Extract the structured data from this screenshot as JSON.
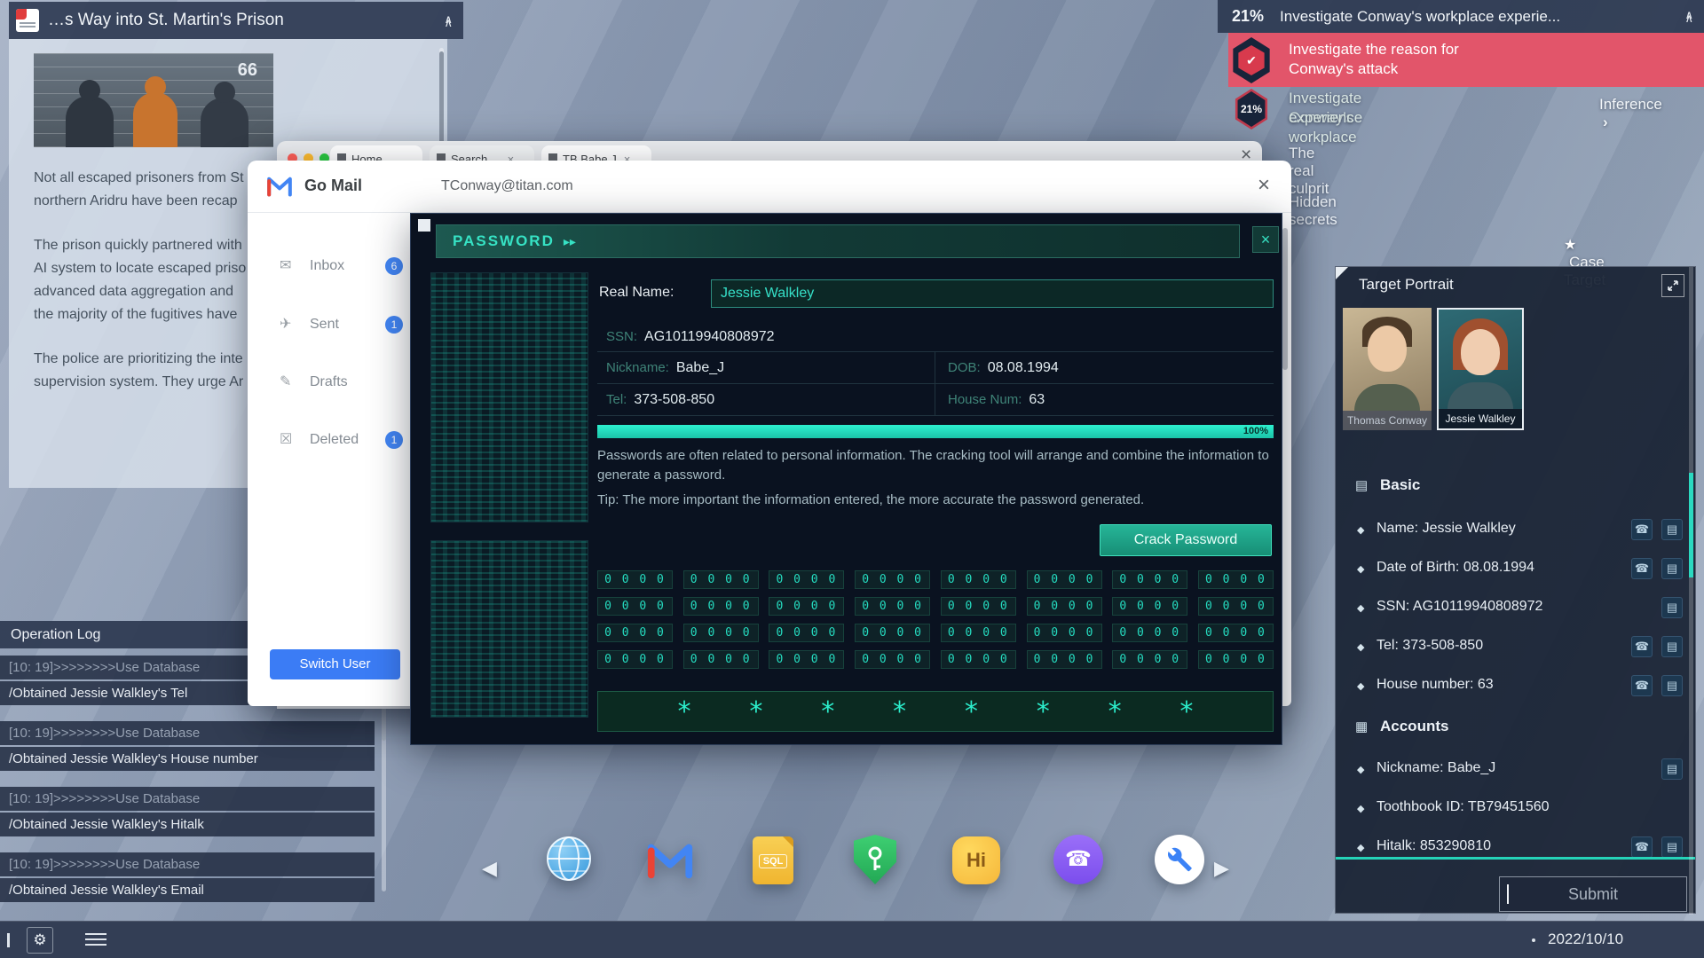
{
  "icons": {
    "collapse": "∧",
    "check": "✔",
    "chevron_right": "›",
    "star": "★",
    "bullet": "◆",
    "close": "×",
    "arrows": "▸▸",
    "contact": "☎",
    "note": "▤",
    "basic_section": "▤",
    "accounts_section": "▦",
    "inbox": "✉",
    "sent": "✈",
    "drafts": "✎",
    "deleted": "☒",
    "gear": "⚙",
    "prev": "◀",
    "next": "▶"
  },
  "news": {
    "title": "…s Way into St. Martin's Prison",
    "image_number": "66",
    "paragraphs": [
      [
        "Not all escaped prisoners from St",
        "northern Aridru have been recap"
      ],
      [
        "The prison quickly partnered with",
        "AI system to locate escaped priso",
        "advanced data aggregation and",
        "the majority of the fugitives have"
      ],
      [
        "The police are prioritizing the inte",
        "supervision system. They urge Ar"
      ]
    ]
  },
  "tasks": {
    "percent": "21%",
    "header_title": "Investigate Conway's workplace experie...",
    "completed": {
      "line1": "Investigate the reason for",
      "line2": "Conway's attack"
    },
    "current": {
      "percent": "21%",
      "line1": "Investigate Conway's workplace",
      "line2": "experience",
      "action": "Inference"
    },
    "items": [
      "The real culprit",
      "Hidden secrets"
    ],
    "case_target_label": "Case Target"
  },
  "target_panel": {
    "title": "Target Portrait",
    "portraits": [
      {
        "name": "Thomas Conway"
      },
      {
        "name": "Jessie Walkley"
      }
    ],
    "basic": {
      "title": "Basic",
      "items": [
        {
          "text": "Name: Jessie Walkley"
        },
        {
          "text": "Date of Birth: 08.08.1994"
        },
        {
          "text": "SSN: AG10119940808972"
        },
        {
          "text": "Tel: 373-508-850"
        },
        {
          "text": "House number: 63"
        }
      ]
    },
    "accounts": {
      "title": "Accounts",
      "items": [
        {
          "text": "Nickname: Babe_J"
        },
        {
          "text": "Toothbook ID: TB79451560"
        },
        {
          "text": "Hitalk: 853290810"
        }
      ]
    },
    "submit_label": "Submit"
  },
  "operation_log": {
    "title": "Operation Log",
    "entries": [
      {
        "line1": "[10: 19]>>>>>>>>Use Database",
        "line2": "/Obtained Jessie Walkley's Tel"
      },
      {
        "line1": "[10: 19]>>>>>>>>Use Database",
        "line2": "/Obtained Jessie Walkley's House number"
      },
      {
        "line1": "[10: 19]>>>>>>>>Use Database",
        "line2": "/Obtained Jessie Walkley's Hitalk"
      },
      {
        "line1": "[10: 19]>>>>>>>>Use Database",
        "line2": "/Obtained Jessie Walkley's Email"
      }
    ]
  },
  "browser": {
    "tabs": [
      {
        "label": "Home"
      },
      {
        "label": "Search ..."
      },
      {
        "label": "TB Babe J"
      }
    ]
  },
  "mail": {
    "brand": "Go Mail",
    "account": "TConway@titan.com",
    "folders": [
      {
        "label": "Inbox",
        "count": "6"
      },
      {
        "label": "Sent",
        "count": "1"
      },
      {
        "label": "Drafts",
        "count": ""
      },
      {
        "label": "Deleted",
        "count": "1"
      }
    ],
    "switch_user": "Switch User"
  },
  "password_tool": {
    "title": "PASSWORD",
    "labels": {
      "real_name": "Real Name:",
      "ssn": "SSN:",
      "nickname": "Nickname:",
      "dob": "DOB:",
      "tel": "Tel:",
      "house": "House Num:"
    },
    "values": {
      "real_name": "Jessie Walkley",
      "ssn": "AG10119940808972",
      "nickname": "Babe_J",
      "dob": "08.08.1994",
      "tel": "373-508-850",
      "house": "63"
    },
    "progress": "100%",
    "desc1": "Passwords are often related to personal information. The cracking tool will arrange and combine the information to generate a password.",
    "desc2": "Tip: The more important the information entered, the more accurate the password generated.",
    "button": "Crack Password",
    "matrix": {
      "rows": 4,
      "groups": 8,
      "cell": "0 0 0 0"
    },
    "result": [
      "*",
      "*",
      "*",
      "*",
      "*",
      "*",
      "*",
      "*"
    ]
  },
  "dock": {
    "sql_label": "SQL",
    "hi_label": "Hi"
  },
  "taskbar": {
    "date": "2022/10/10"
  }
}
